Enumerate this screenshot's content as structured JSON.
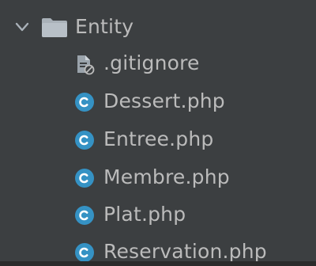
{
  "project_tree": {
    "folder": {
      "name": "Entity",
      "expanded": true,
      "icon": "folder-icon",
      "color": "#a9b1b8"
    },
    "files": [
      {
        "name": ".gitignore",
        "icon": "ignored-file-icon"
      },
      {
        "name": "Dessert.php",
        "icon": "php-class-icon"
      },
      {
        "name": "Entree.php",
        "icon": "php-class-icon"
      },
      {
        "name": "Membre.php",
        "icon": "php-class-icon"
      },
      {
        "name": "Plat.php",
        "icon": "php-class-icon"
      },
      {
        "name": "Reservation.php",
        "icon": "php-class-icon"
      }
    ]
  },
  "colors": {
    "background": "#3c3f41",
    "text": "#bbbbbb",
    "class_icon": "#3592c4",
    "class_icon_letter": "#ffffff"
  }
}
